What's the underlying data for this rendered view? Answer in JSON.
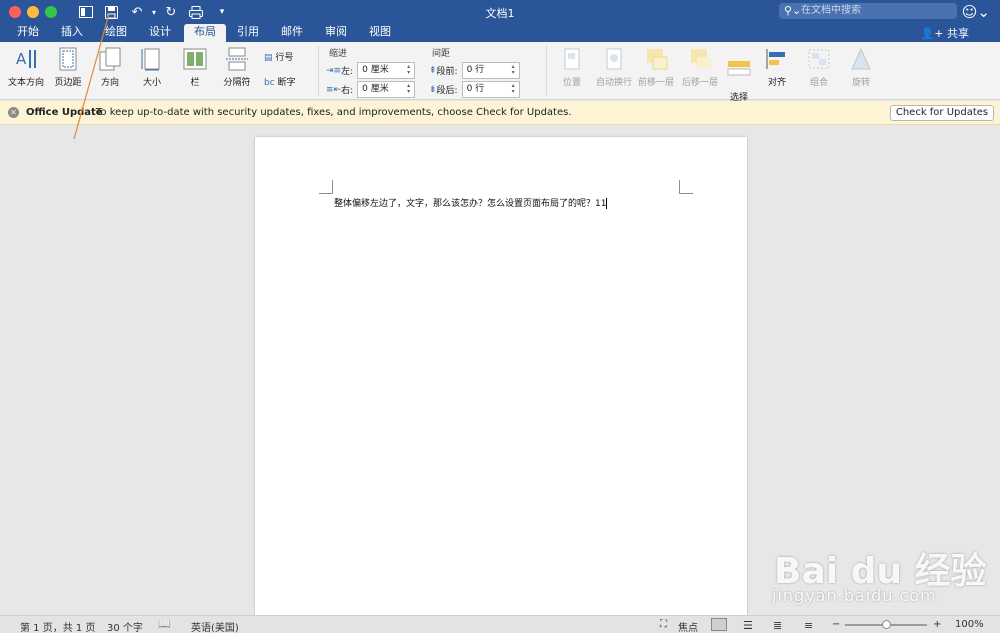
{
  "window": {
    "title": "文档1",
    "search_placeholder": "在文档中搜索",
    "share_label": "共享"
  },
  "tabs": [
    "开始",
    "插入",
    "绘图",
    "设计",
    "布局",
    "引用",
    "邮件",
    "审阅",
    "视图"
  ],
  "active_tab": "布局",
  "ribbon": {
    "text_direction": "文本方向",
    "margins": "页边距",
    "orientation": "方向",
    "size": "大小",
    "columns": "栏",
    "breaks": "分隔符",
    "line_numbers": "行号",
    "hyphenation": "断字",
    "indent_group": "缩进",
    "indent_left_label": "左:",
    "indent_left_value": "0 厘米",
    "indent_right_label": "右:",
    "indent_right_value": "0 厘米",
    "spacing_group": "间距",
    "spacing_before_label": "段前:",
    "spacing_before_value": "0 行",
    "spacing_after_label": "段后:",
    "spacing_after_value": "0 行",
    "position": "位置",
    "wrap_text": "自动换行",
    "bring_forward": "前移一层",
    "send_backward": "后移一层",
    "selection_pane": "选择\n窗格",
    "align": "对齐",
    "group": "组合",
    "rotate": "旋转"
  },
  "update_bar": {
    "title": "Office Update",
    "message": "To keep up-to-date with security updates, fixes, and improvements, choose Check for Updates.",
    "button": "Check for Updates"
  },
  "document": {
    "text": "整体偏移左边了，文字，那么该怎办？怎么设置页面布局了的呢？11"
  },
  "status": {
    "page": "第 1 页，共 1 页",
    "words": "30 个字",
    "language": "英语(美国)",
    "focus": "焦点",
    "zoom": "100%",
    "zoom_fraction": 0.5
  },
  "watermark": {
    "brand": "Bai du 经验",
    "url": "jingyan.baidu.com"
  },
  "colors": {
    "titlebar": "#2a5699",
    "ribbon": "#f3f3f3",
    "update_bar": "#fcf4d4",
    "annotation": "#e08a3c"
  }
}
